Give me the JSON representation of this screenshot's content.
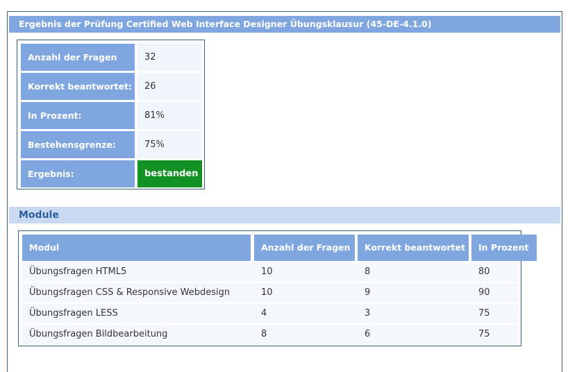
{
  "header": {
    "title": "Ergebnis der Prüfung Certified Web Interface Designer Übungsklausur (45-DE-4.1.0)"
  },
  "result": {
    "rows": [
      {
        "label": "Anzahl der Fragen",
        "value": "32"
      },
      {
        "label": "Korrekt beantwortet:",
        "value": "26"
      },
      {
        "label": "In Prozent:",
        "value": "81%"
      },
      {
        "label": "Bestehensgrenze:",
        "value": "75%"
      },
      {
        "label": "Ergebnis:",
        "value": "bestanden"
      }
    ]
  },
  "modules": {
    "title": "Module",
    "columns": [
      "Modul",
      "Anzahl der Fragen",
      "Korrekt beantwortet",
      "In Prozent"
    ],
    "rows": [
      [
        "Übungsfragen HTML5",
        "10",
        "8",
        "80"
      ],
      [
        "Übungsfragen CSS & Responsive Webdesign",
        "10",
        "9",
        "90"
      ],
      [
        "Übungsfragen LESS",
        "4",
        "3",
        "75"
      ],
      [
        "Übungsfragen Bildbearbeitung",
        "8",
        "6",
        "75"
      ]
    ]
  },
  "colors": {
    "header_blue": "#7fa6df",
    "module_bar": "#c9d9f2",
    "pass_green": "#129125",
    "border": "#34607a"
  }
}
